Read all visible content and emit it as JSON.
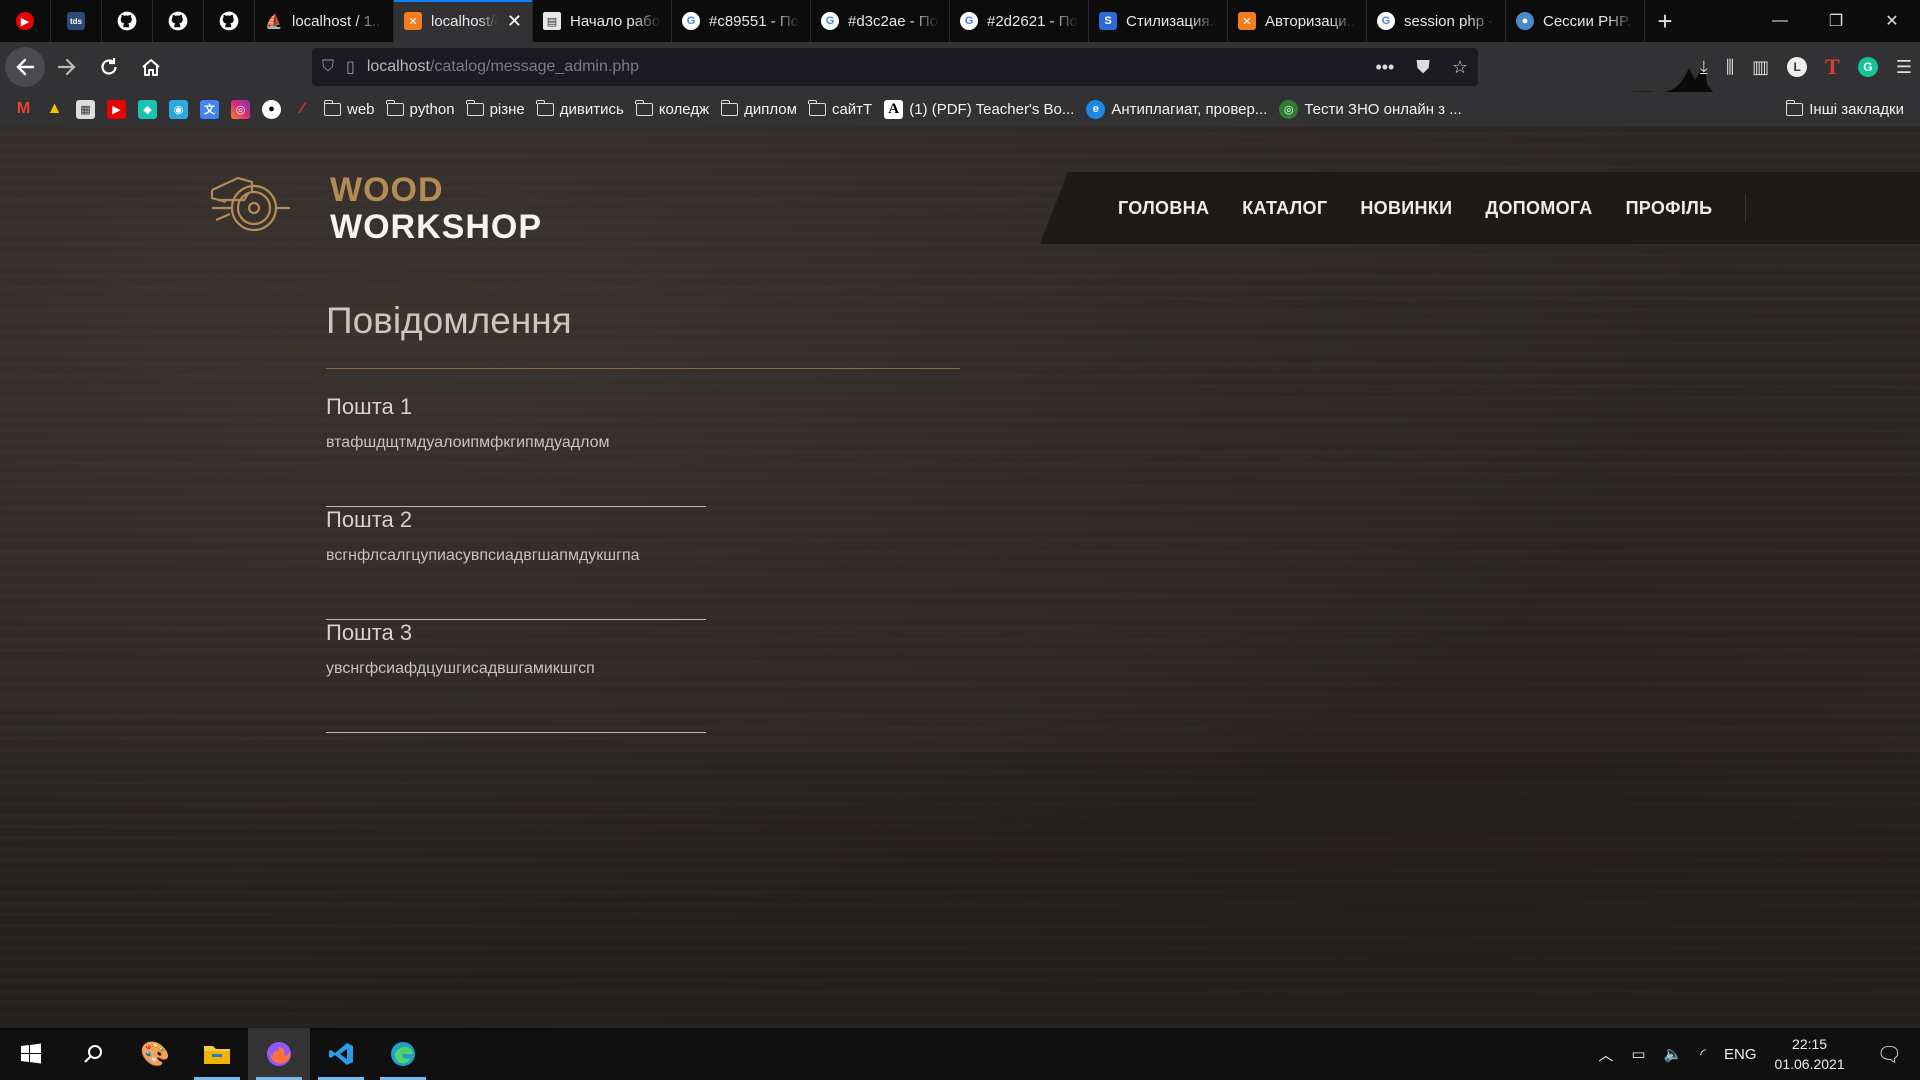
{
  "browser": {
    "tabs": [
      {
        "label": "localhost / 1...",
        "icon": "phpmyadmin-icon",
        "active": false
      },
      {
        "label": "localhost/c...",
        "icon": "xampp-icon",
        "active": true
      },
      {
        "label": "Начало рабо...",
        "icon": "document-icon",
        "active": false
      },
      {
        "label": "#c89551 - По...",
        "icon": "google-icon",
        "active": false
      },
      {
        "label": "#d3c2ae - По...",
        "icon": "google-icon",
        "active": false
      },
      {
        "label": "#2d2621 - По...",
        "icon": "google-icon",
        "active": false
      },
      {
        "label": "Стилизация...",
        "icon": "s-icon",
        "active": false
      },
      {
        "label": "Авторизаци...",
        "icon": "xampp-icon",
        "active": false
      },
      {
        "label": "session php -...",
        "icon": "google-icon",
        "active": false
      },
      {
        "label": "Сессии PHP...",
        "icon": "php-icon",
        "active": false
      }
    ],
    "url_host": "localhost",
    "url_path": "/catalog/message_admin.php",
    "bookmarks": [
      {
        "label": "web"
      },
      {
        "label": "python"
      },
      {
        "label": "різне"
      },
      {
        "label": "дивитись"
      },
      {
        "label": "коледж"
      },
      {
        "label": "диплом"
      },
      {
        "label": "сайтТ"
      }
    ],
    "bookmark_links": [
      {
        "label": "(1) (PDF) Teacher's Bo..."
      },
      {
        "label": "Антиплагиат, провер..."
      },
      {
        "label": "Тести ЗНО онлайн з ..."
      }
    ],
    "other_bookmarks": "Інші закладки"
  },
  "site": {
    "logo_line1": "WOOD",
    "logo_line2": "WORKSHOP",
    "menu": [
      {
        "label": "ГОЛОВНА"
      },
      {
        "label": "КАТАЛОГ"
      },
      {
        "label": "НОВИНКИ"
      },
      {
        "label": "ДОПОМОГА"
      },
      {
        "label": "ПРОФІЛЬ"
      }
    ],
    "page_title": "Повідомлення",
    "messages": [
      {
        "title": "Пошта 1",
        "body": "втафшдщтмдуалоипмфкгипмдуадлом"
      },
      {
        "title": "Пошта 2",
        "body": "всгнфлсалгцупиасувпсиадвгшапмдукшгпа"
      },
      {
        "title": "Пошта 3",
        "body": "увснгфсиафдцушгисадвшгамикшгсп"
      }
    ]
  },
  "taskbar": {
    "language": "ENG",
    "time": "22:15",
    "date": "01.06.2021"
  },
  "colors": {
    "accent_wood": "#b38b55",
    "tab_active_indicator": "#0a84ff",
    "background": "#2c2725"
  }
}
